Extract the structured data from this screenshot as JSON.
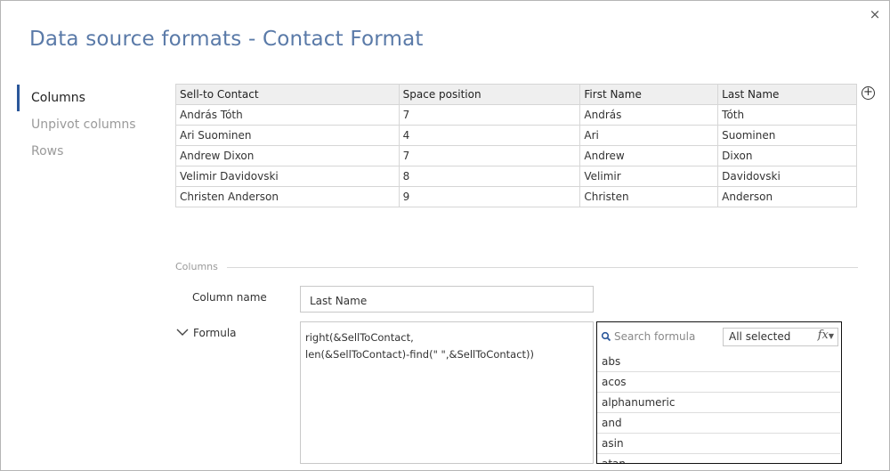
{
  "dialog": {
    "title": "Data source formats - Contact Format",
    "close_label": "×"
  },
  "nav": {
    "items": [
      {
        "label": "Columns"
      },
      {
        "label": "Unpivot columns"
      },
      {
        "label": "Rows"
      }
    ]
  },
  "preview_table": {
    "headers": [
      "Sell-to Contact",
      "Space position",
      "First Name",
      "Last Name"
    ],
    "rows": [
      [
        "András Tóth",
        "7",
        "András",
        "Tóth"
      ],
      [
        "Ari Suominen",
        "4",
        "Ari",
        "Suominen"
      ],
      [
        "Andrew Dixon",
        "7",
        "Andrew",
        "Dixon"
      ],
      [
        "Velimir Davidovski",
        "8",
        "Velimir",
        "Davidovski"
      ],
      [
        "Christen Anderson",
        "9",
        "Christen",
        "Anderson"
      ]
    ],
    "add_label": "+"
  },
  "columns_section": {
    "label": "Columns",
    "column_name_label": "Column name",
    "column_name_value": "Last Name",
    "formula_label": "Formula",
    "formula_lines": [
      "right(&SellToContact,",
      "len(&SellToContact)-find(\" \",&SellToContact))"
    ]
  },
  "formula_picker": {
    "search_placeholder": "Search formula",
    "filter_value": "All selected",
    "fx_label": "fx",
    "functions": [
      "abs",
      "acos",
      "alphanumeric",
      "and",
      "asin",
      "atan"
    ]
  }
}
